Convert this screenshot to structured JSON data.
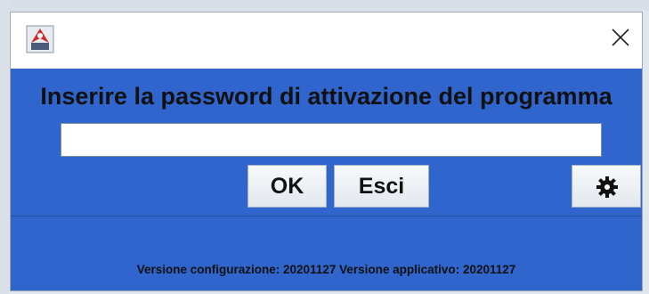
{
  "window": {
    "app_icon": "java-app-icon",
    "close_icon": "close-icon"
  },
  "dialog": {
    "prompt": "Inserire la password di attivazione del programma",
    "password_value": "",
    "ok_label": "OK",
    "cancel_label": "Esci",
    "settings_icon": "gear-icon"
  },
  "footer": {
    "config_version_label": "Versione configurazione:",
    "config_version_value": "20201127",
    "app_version_label": "Versione applicativo:",
    "app_version_value": "20201127"
  },
  "colors": {
    "panel_background": "#2f65cc",
    "title_bar": "#ffffff"
  }
}
